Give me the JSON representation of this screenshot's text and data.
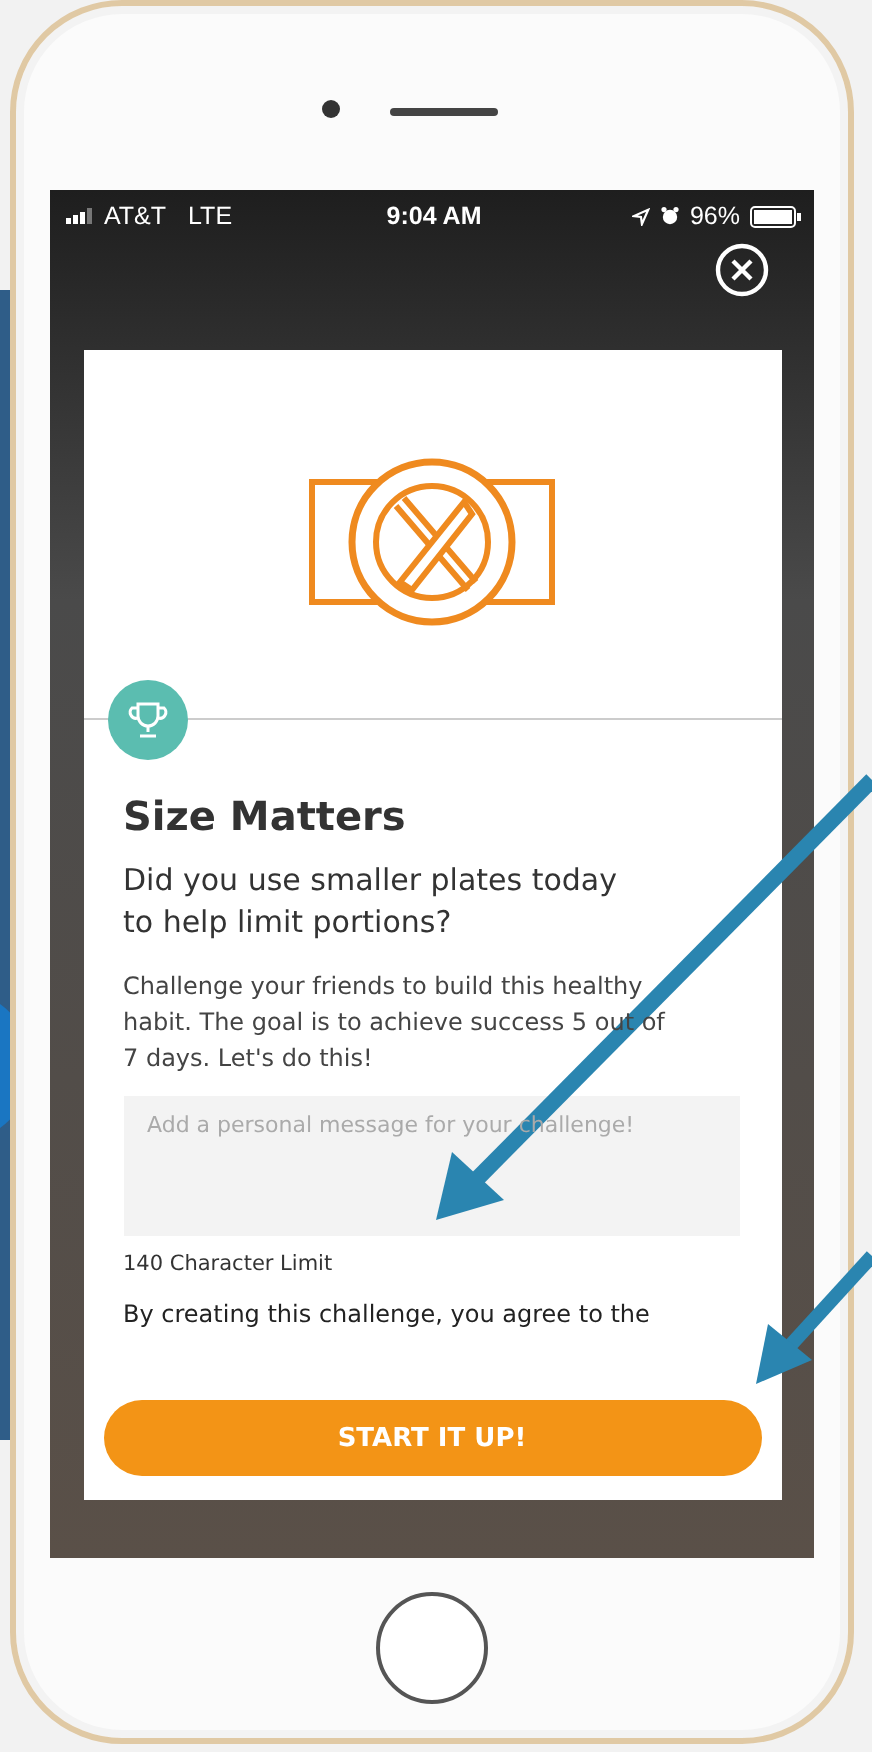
{
  "status_bar": {
    "carrier": "AT&T",
    "network": "LTE",
    "time": "9:04 AM",
    "battery": "96%"
  },
  "challenge": {
    "title": "Size Matters",
    "question": "Did you use smaller plates today to help limit portions?",
    "description": "Challenge your friends to build this healthy habit. The goal is to achieve success 5 out of 7 days. Let's do this!",
    "message_field": {
      "placeholder": "Add a personal message for your challenge!"
    },
    "character_limit": "140 Character Limit",
    "terms": "By creating this challenge, you agree to the"
  },
  "primary_button": "START IT UP!"
}
